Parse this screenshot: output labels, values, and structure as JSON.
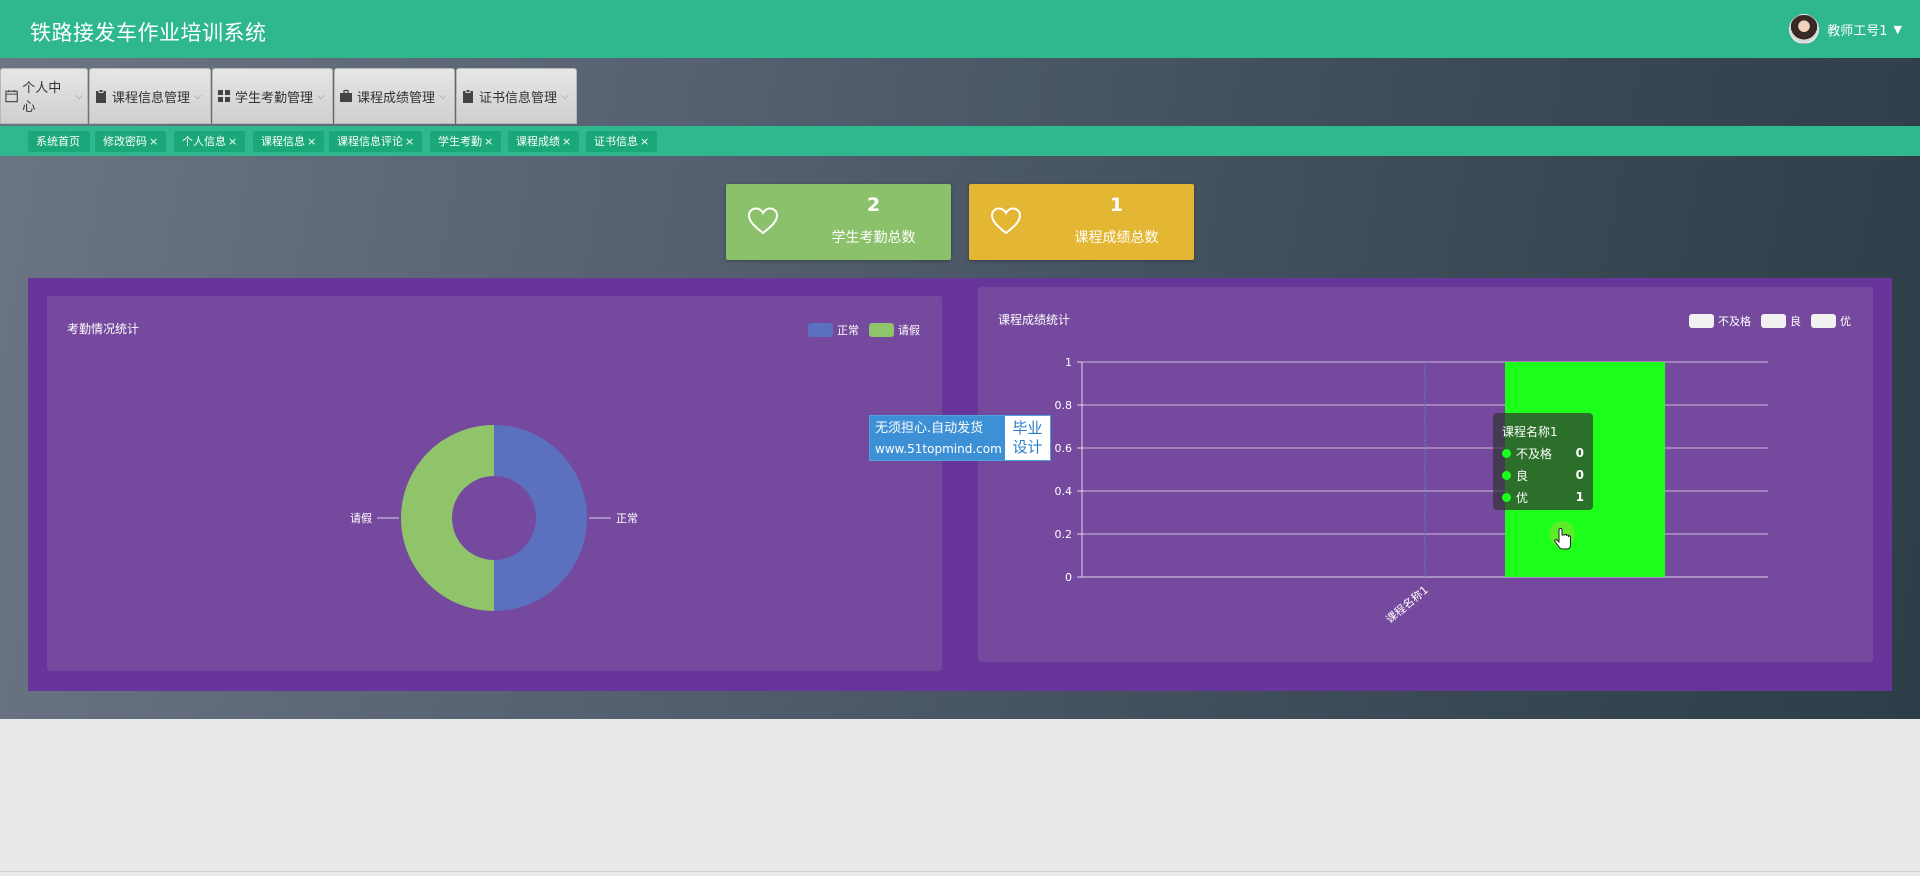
{
  "app": {
    "title": "铁路接发车作业培训系统"
  },
  "user": {
    "name": "教师工号1",
    "avatar_icon": "user-avatar",
    "caret_icon": "caret-down-icon"
  },
  "menu": [
    {
      "label": "个人中心",
      "icon": "calendar-icon"
    },
    {
      "label": "课程信息管理",
      "icon": "clipboard-icon"
    },
    {
      "label": "学生考勤管理",
      "icon": "grid-icon"
    },
    {
      "label": "课程成绩管理",
      "icon": "briefcase-icon"
    },
    {
      "label": "证书信息管理",
      "icon": "clipboard-icon"
    }
  ],
  "tags": [
    {
      "label": "系统首页",
      "close": ""
    },
    {
      "label": "修改密码",
      "close": "×"
    },
    {
      "label": "个人信息",
      "close": "×"
    },
    {
      "label": "课程信息",
      "close": "×"
    },
    {
      "label": "课程信息评论",
      "close": "×"
    },
    {
      "label": "学生考勤",
      "close": "×"
    },
    {
      "label": "课程成绩",
      "close": "×"
    },
    {
      "label": "证书信息",
      "close": "×"
    }
  ],
  "cards": [
    {
      "value": "2",
      "label": "学生考勤总数",
      "color": "#8cc16b",
      "icon": "heart-icon"
    },
    {
      "value": "1",
      "label": "课程成绩总数",
      "color": "#e3b733",
      "icon": "heart-icon"
    }
  ],
  "colors": {
    "accent": "#2fb88e",
    "panel_outer": "#68359a",
    "panel_inner": "#754a9e"
  },
  "chart_data": [
    {
      "type": "pie",
      "variant": "donut",
      "title": "考勤情况统计",
      "legend_position": "top-right",
      "slices": [
        {
          "name": "正常",
          "value": 1,
          "color": "#5b70be"
        },
        {
          "name": "请假",
          "value": 1,
          "color": "#8fc46a"
        }
      ]
    },
    {
      "type": "bar",
      "title": "课程成绩统计",
      "legend_position": "top-right",
      "categories": [
        "课程名称1"
      ],
      "series": [
        {
          "name": "不及格",
          "values": [
            0
          ],
          "color": "#f1f1f1"
        },
        {
          "name": "良",
          "values": [
            0
          ],
          "color": "#f1f1f1"
        },
        {
          "name": "优",
          "values": [
            1
          ],
          "color": "#1bff1b"
        }
      ],
      "ylim": [
        0,
        1
      ],
      "yticks": [
        "0",
        "0.2",
        "0.4",
        "0.6",
        "0.8",
        "1"
      ],
      "grid": true,
      "tooltip": {
        "title": "课程名称1",
        "rows": [
          {
            "name": "不及格",
            "value": "0"
          },
          {
            "name": "良",
            "value": "0"
          },
          {
            "name": "优",
            "value": "1"
          }
        ]
      }
    }
  ],
  "watermark": {
    "line1": "无须担心.自动发货",
    "line2": "www.51topmind.com",
    "right1": "毕业",
    "right2": "设计"
  }
}
